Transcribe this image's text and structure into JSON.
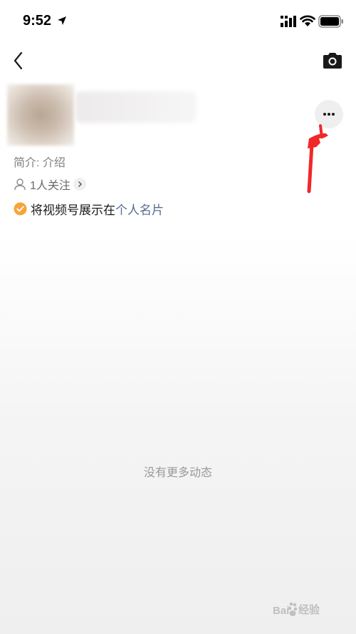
{
  "status_bar": {
    "time": "9:52"
  },
  "profile": {
    "bio": "简介: 介绍",
    "followers": "1人关注",
    "showcase_prefix": "将视频号展示在",
    "showcase_link": "个人名片"
  },
  "feed": {
    "empty_message": "没有更多动态"
  },
  "watermark": {
    "text": "经验",
    "brand": "Baidu"
  },
  "colors": {
    "link": "#576b95",
    "check": "#f6a43a",
    "annotation": "#f0282a"
  }
}
